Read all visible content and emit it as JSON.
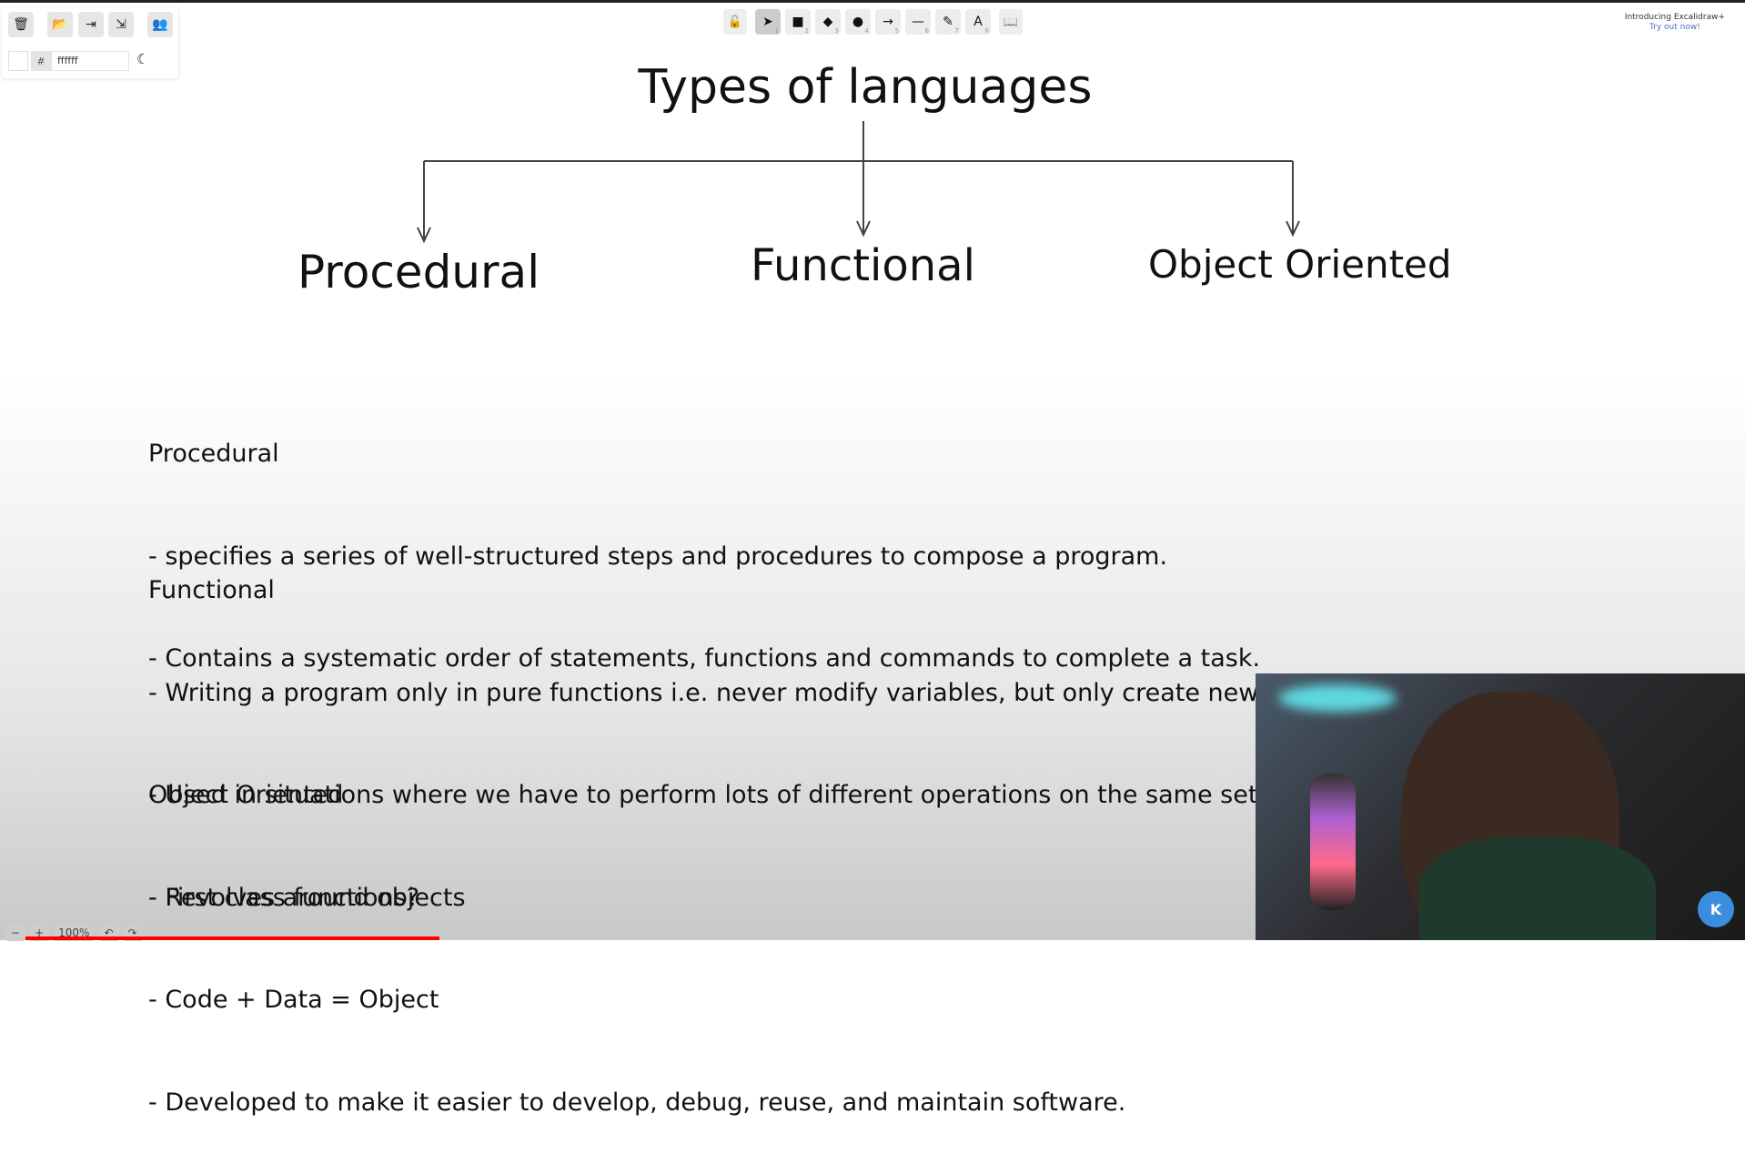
{
  "toolbar_left": {
    "icons": [
      "trash-icon",
      "folder-open-icon",
      "export-icon",
      "export-image-icon",
      "collaborators-icon"
    ],
    "color_hash": "#",
    "color_value": "ffffff",
    "theme_icon": "moon-icon"
  },
  "tools": [
    {
      "icon": "pointer",
      "glyph": "➤",
      "key": "1"
    },
    {
      "icon": "rectangle",
      "glyph": "■",
      "key": "2"
    },
    {
      "icon": "diamond",
      "glyph": "◆",
      "key": "3"
    },
    {
      "icon": "ellipse",
      "glyph": "●",
      "key": "4"
    },
    {
      "icon": "arrow",
      "glyph": "→",
      "key": "5"
    },
    {
      "icon": "line",
      "glyph": "—",
      "key": "6"
    },
    {
      "icon": "pencil",
      "glyph": "✎",
      "key": "7"
    },
    {
      "icon": "text",
      "glyph": "A",
      "key": "8"
    }
  ],
  "promo": {
    "line1": "Introducing Excalidraw+",
    "line2": "Try out now!"
  },
  "canvas": {
    "title": "Types of languages",
    "branches": [
      "Procedural",
      "Functional",
      "Object Oriented"
    ],
    "notes": [
      {
        "heading": "Procedural",
        "items": [
          "- specifies a series of well-structured steps and procedures to compose a program.",
          "- Contains a systematic order of statements, functions and commands to complete a task."
        ]
      },
      {
        "heading": "Functional",
        "items": [
          "- Writing a program only in pure functions i.e. never modify variables, but only create new ones as an output.",
          "- Used in situations where we have to perform lots of different operations on the same set of data, like ML.",
          "- First class functions?"
        ]
      },
      {
        "heading": "Object Oriented",
        "items": [
          "- Revolves around objects",
          "- Code + Data = Object",
          "- Developed to make it easier to develop, debug, reuse, and maintain software."
        ]
      }
    ]
  },
  "zoom": {
    "minus": "−",
    "plus": "+",
    "level": "100%"
  },
  "video_progress": 0.25
}
